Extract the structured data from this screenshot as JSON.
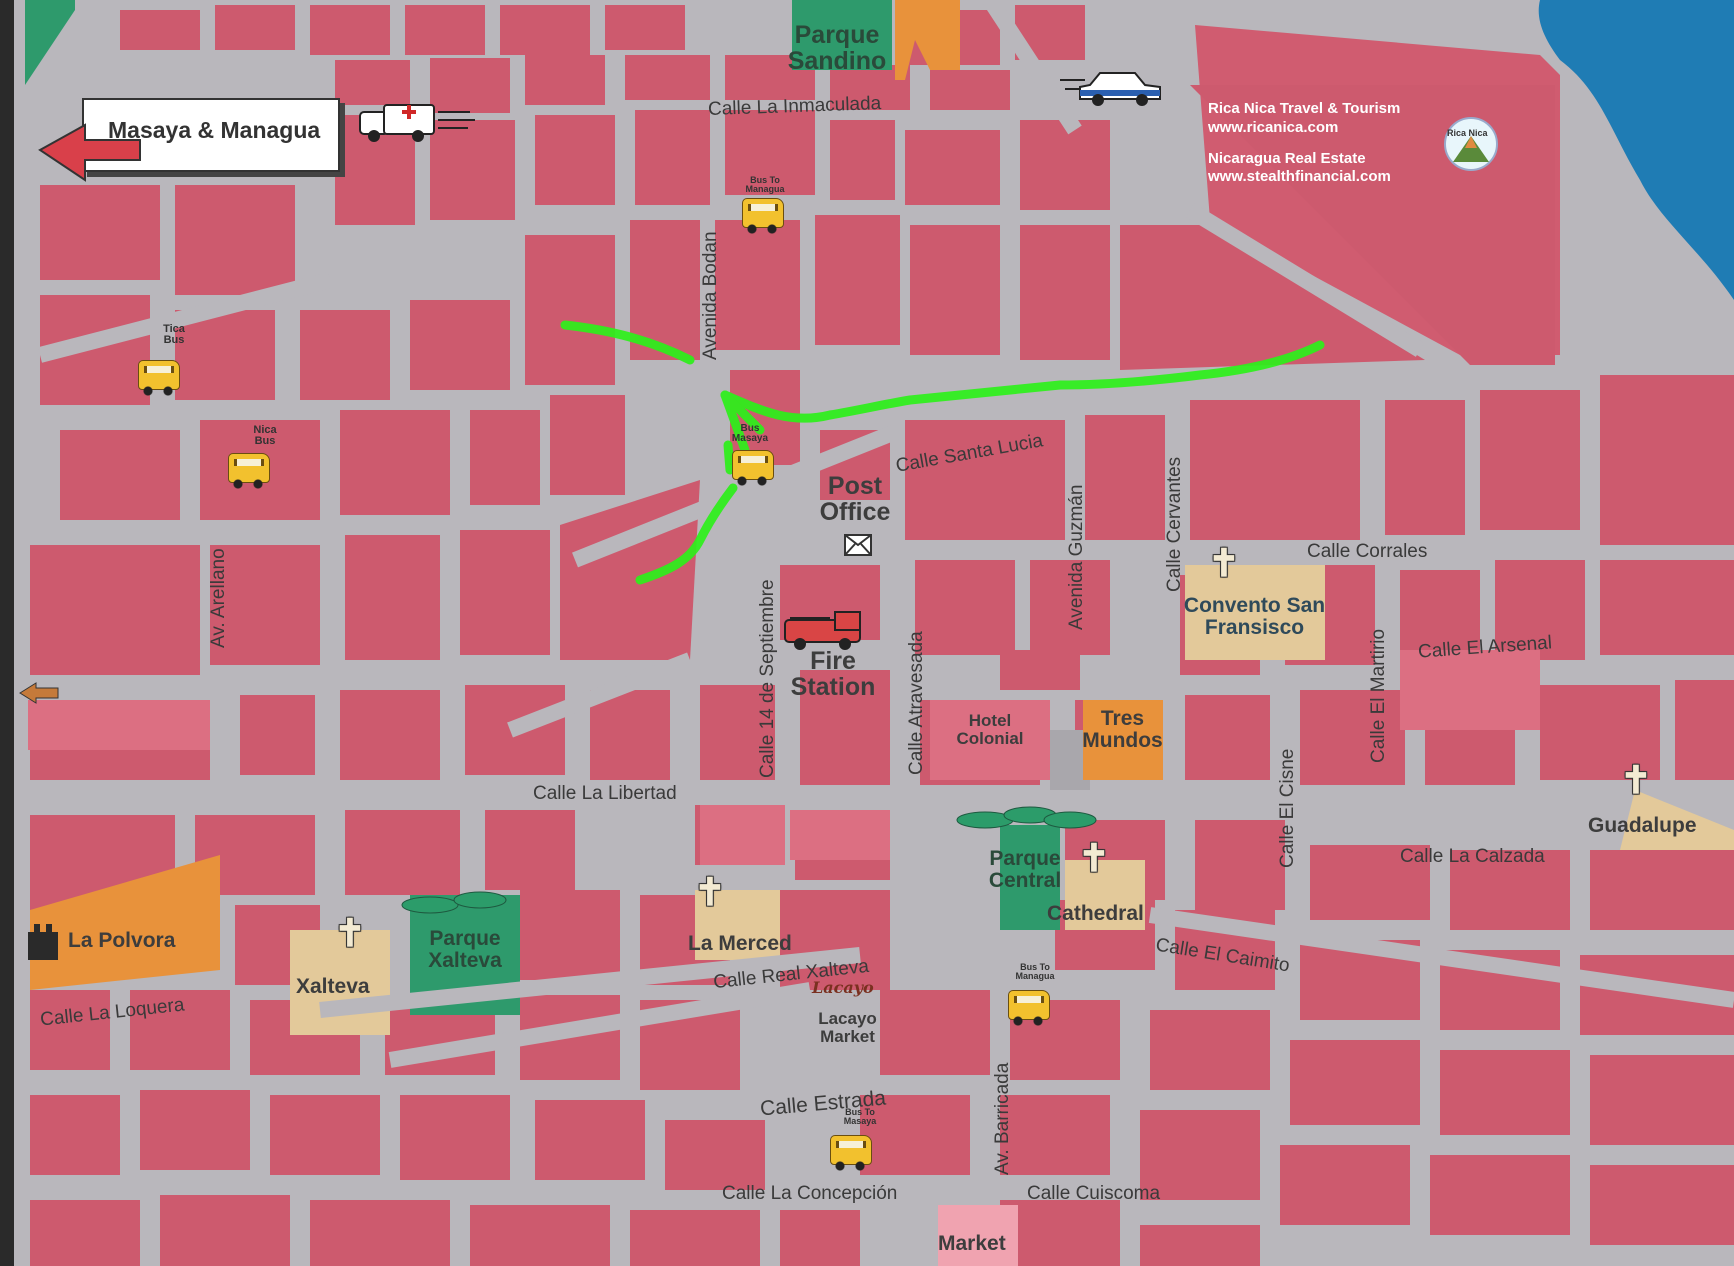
{
  "map": {
    "colors": {
      "block": "#cd5a6e",
      "block_alt": "#d8607a",
      "road": "#b9b7bc",
      "park": "#2e9a6c",
      "landmark_tan": "#e3c99a",
      "landmark_orange": "#e8923b",
      "water": "#1f7cb4",
      "route": "#2cf01a"
    },
    "header_sign": {
      "text": "Masaya & Managua",
      "icon": "left-arrow-icon"
    },
    "inset_info": {
      "line1": "Rica Nica Travel & Tourism",
      "line2": "www.ricanica.com",
      "line3": "Nicaragua Real Estate",
      "line4": "www.stealthfinancial.com",
      "logo_text": "Rica Nica"
    },
    "streets": {
      "calle_la_inmaculada": "Calle La Inmaculada",
      "avenida_bodan": "Avenida Bodan",
      "calle_santa_lucia": "Calle Santa Lucia",
      "av_arellano": "Av. Arellano",
      "calle_14_septiembre": "Calle 14 de Septiembre",
      "calle_atravesada": "Calle Atravesada",
      "avenida_guzman": "Avenida Guzmán",
      "calle_cervantes": "Calle Cervantes",
      "calle_corrales": "Calle Corrales",
      "calle_el_arsenal": "Calle El Arsenal",
      "calle_el_martirio": "Calle El Martirio",
      "calle_el_cisne": "Calle El Cisne",
      "calle_la_libertad": "Calle La Libertad",
      "calle_la_calzada": "Calle La Calzada",
      "calle_el_caimito": "Calle El Caimito",
      "calle_real_xalteva": "Calle Real Xalteva",
      "calle_la_loquera": "Calle La Loquera",
      "calle_estrada": "Calle Estrada",
      "av_barricada": "Av. Barricada",
      "calle_la_concepcion": "Calle La Concepción",
      "calle_cuiscoma": "Calle Cuiscoma"
    },
    "places": {
      "parque_sandino": "Parque Sandino",
      "post_office": "Post Office",
      "fire_station": "Fire Station",
      "hotel_colonial": "Hotel Colonial",
      "tres_mundos": "Tres Mundos",
      "convento": "Convento San Fransisco",
      "guadalupe": "Guadalupe",
      "parque_central": "Parque Central",
      "cathedral": "Cathedral",
      "la_merced": "La Merced",
      "la_polvora": "La Polvora",
      "xalteva": "Xalteva",
      "parque_xalteva": "Parque Xalteva",
      "lacayo_market": "Lacayo Market",
      "lacayo_logo": "Lacayo",
      "market": "Market"
    },
    "buses": {
      "tica": "Tica Bus",
      "nica": "Nica Bus",
      "to_managua_top": "Bus To Managua",
      "masaya_mid": "Bus Masaya",
      "to_managua_bottom": "Bus To Managua",
      "to_masaya_bottom": "Bus To Masaya"
    },
    "icons": {
      "ambulance": "ambulance-icon",
      "police": "police-car-icon",
      "fire_truck": "fire-truck-icon",
      "mail": "envelope-icon",
      "church": "church-cross-icon",
      "fort": "fort-icon",
      "bus": "bus-icon"
    },
    "route_note": "green highlighted walking route"
  }
}
